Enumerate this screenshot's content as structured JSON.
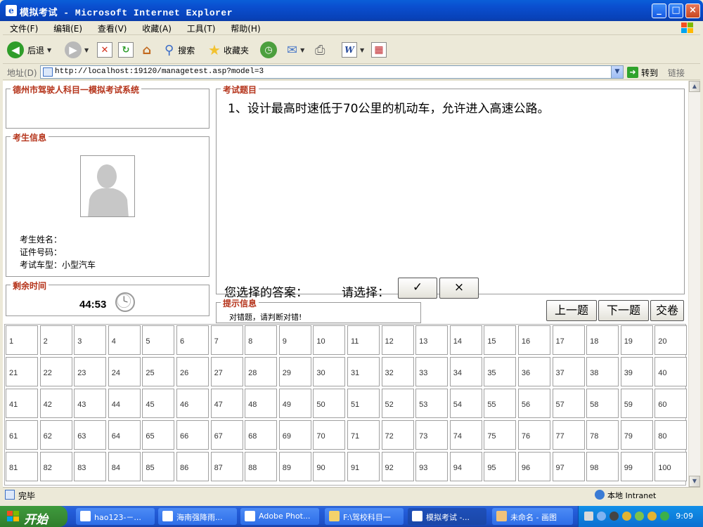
{
  "window": {
    "title": "模拟考试 - Microsoft Internet Explorer",
    "minimize": "_",
    "maximize": "□",
    "close": "×"
  },
  "menu": [
    "文件(F)",
    "编辑(E)",
    "查看(V)",
    "收藏(A)",
    "工具(T)",
    "帮助(H)"
  ],
  "toolbar": {
    "back": "后退",
    "search": "搜索",
    "favorites": "收藏夹"
  },
  "address": {
    "label": "地址(D)",
    "url": "http://localhost:19120/managetest.asp?model=3",
    "go": "转到",
    "links": "链接"
  },
  "exam": {
    "system_title": "德州市驾驶人科目一模拟考试系统",
    "candidate_legend": "考生信息",
    "name_label": "考生姓名：",
    "id_label": "证件号码：",
    "vehicle_label": "考试车型：小型汽车",
    "time_legend": "剩余时间",
    "time_left": "44:53",
    "question_legend": "考试题目",
    "question": "1、设计最高时速低于70公里的机动车，允许进入高速公路。",
    "answer_label": "您选择的答案：",
    "choose_label": "请选择：",
    "btn_correct": "✓",
    "btn_wrong": "×",
    "hint_legend": "提示信息",
    "hint": "对错题，请判断对错!",
    "prev": "上一题",
    "next": "下一题",
    "submit": "交卷"
  },
  "questions": [
    "1",
    "2",
    "3",
    "4",
    "5",
    "6",
    "7",
    "8",
    "9",
    "10",
    "11",
    "12",
    "13",
    "14",
    "15",
    "16",
    "17",
    "18",
    "19",
    "20",
    "21",
    "22",
    "23",
    "24",
    "25",
    "26",
    "27",
    "28",
    "29",
    "30",
    "31",
    "32",
    "33",
    "34",
    "35",
    "36",
    "37",
    "38",
    "39",
    "40",
    "41",
    "42",
    "43",
    "44",
    "45",
    "46",
    "47",
    "48",
    "49",
    "50",
    "51",
    "52",
    "53",
    "54",
    "55",
    "56",
    "57",
    "58",
    "59",
    "60",
    "61",
    "62",
    "63",
    "64",
    "65",
    "66",
    "67",
    "68",
    "69",
    "70",
    "71",
    "72",
    "73",
    "74",
    "75",
    "76",
    "77",
    "78",
    "79",
    "80",
    "81",
    "82",
    "83",
    "84",
    "85",
    "86",
    "87",
    "88",
    "89",
    "90",
    "91",
    "92",
    "93",
    "94",
    "95",
    "96",
    "97",
    "98",
    "99",
    "100"
  ],
  "status": {
    "text": "完毕",
    "zone": "本地 Intranet"
  },
  "taskbar": {
    "start": "开始",
    "tasks": [
      "hao123-－...",
      "海南强降雨...",
      "Adobe Phot...",
      "F:\\驾校科目一",
      "模拟考试 -...",
      "未命名 - 画图"
    ],
    "clock": "9:09"
  },
  "colors": {
    "legend": "#B5341B",
    "titlebar": "#0842B9",
    "taskbar": "#245EDB"
  }
}
